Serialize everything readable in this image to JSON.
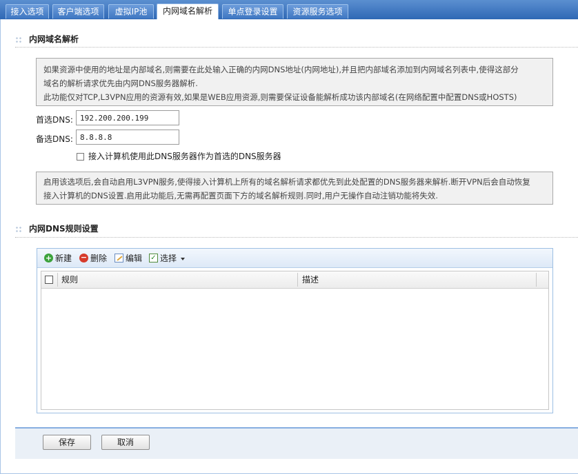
{
  "tabs": [
    {
      "label": "接入选项",
      "active": false
    },
    {
      "label": "客户端选项",
      "active": false
    },
    {
      "label": "虚拟IP池",
      "active": false
    },
    {
      "label": "内网域名解析",
      "active": true
    },
    {
      "label": "单点登录设置",
      "active": false
    },
    {
      "label": "资源服务选项",
      "active": false
    }
  ],
  "dns_section": {
    "title": "内网域名解析",
    "info_line1": "如果资源中使用的地址是内部域名,则需要在此处输入正确的内网DNS地址(内网地址),并且把内部域名添加到内网域名列表中,使得这部分",
    "info_line2": "域名的解析请求优先由内网DNS服务器解析.",
    "info_line3": "此功能仅对TCP,L3VPN应用的资源有效,如果是WEB应用资源,则需要保证设备能解析成功该内部域名(在网络配置中配置DNS或HOSTS)",
    "primary_label": "首选DNS:",
    "primary_value": "192.200.200.199",
    "secondary_label": "备选DNS:",
    "secondary_value": "8.8.8.8",
    "checkbox_label": "接入计算机使用此DNS服务器作为首选的DNS服务器",
    "checkbox_checked": false,
    "note_line1": "启用该选项后,会自动启用L3VPN服务,使得接入计算机上所有的域名解析请求都优先到此处配置的DNS服务器来解析.断开VPN后会自动恢复",
    "note_line2": "接入计算机的DNS设置.启用此功能后,无需再配置页面下方的域名解析规则.同时,用户无操作自动注销功能将失效."
  },
  "rules_section": {
    "title": "内网DNS规则设置",
    "toolbar": {
      "new_label": "新建",
      "delete_label": "删除",
      "edit_label": "编辑",
      "select_label": "选择"
    },
    "columns": [
      "规则",
      "描述"
    ],
    "rows": []
  },
  "footer": {
    "save_label": "保存",
    "cancel_label": "取消"
  },
  "colors": {
    "tabbar": "#2f68b5",
    "footer_border": "#86aee0",
    "new_icon": "#3ca23c",
    "delete_icon": "#d63b2b"
  }
}
